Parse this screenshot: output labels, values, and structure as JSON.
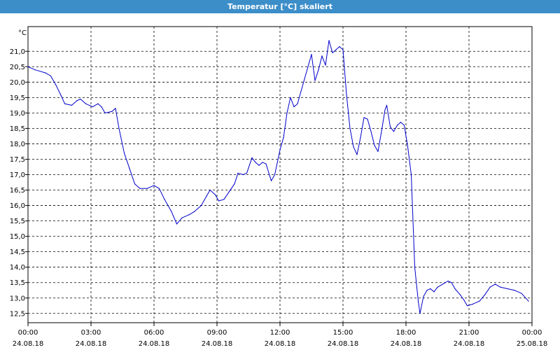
{
  "window": {
    "title": "Temperatur [°C] skaliert"
  },
  "colors": {
    "titlebar": "#3c8ec9",
    "series": "#0000cc",
    "grid": "#000000"
  },
  "chart_data": {
    "type": "line",
    "title": "Temperatur [°C] skaliert",
    "ylabel": "°C",
    "xlabel": "",
    "ylim": [
      12.2,
      21.8
    ],
    "xlim": [
      "2018-08-24 00:00",
      "2018-08-25 00:00"
    ],
    "grid": true,
    "legend": "none",
    "y_ticks": [
      "12,5",
      "13,0",
      "13,5",
      "14,0",
      "14,5",
      "15,0",
      "15,5",
      "16,0",
      "16,5",
      "17,0",
      "17,5",
      "18,0",
      "18,5",
      "19,0",
      "19,5",
      "20,0",
      "20,5",
      "21,0"
    ],
    "x_ticks": [
      {
        "time": "00:00",
        "date": "24.08.18"
      },
      {
        "time": "03:00",
        "date": "24.08.18"
      },
      {
        "time": "06:00",
        "date": "24.08.18"
      },
      {
        "time": "09:00",
        "date": "24.08.18"
      },
      {
        "time": "12:00",
        "date": "24.08.18"
      },
      {
        "time": "15:00",
        "date": "24.08.18"
      },
      {
        "time": "18:00",
        "date": "24.08.18"
      },
      {
        "time": "21:00",
        "date": "24.08.18"
      },
      {
        "time": "00:00",
        "date": "25.08.18"
      }
    ],
    "series": [
      {
        "color": "#0000cc",
        "points": [
          [
            "2018-08-24 00:00",
            20.5
          ],
          [
            "2018-08-24 00:20",
            20.4
          ],
          [
            "2018-08-24 00:50",
            20.3
          ],
          [
            "2018-08-24 01:05",
            20.2
          ],
          [
            "2018-08-24 01:20",
            19.9
          ],
          [
            "2018-08-24 01:35",
            19.55
          ],
          [
            "2018-08-24 01:45",
            19.3
          ],
          [
            "2018-08-24 02:05",
            19.25
          ],
          [
            "2018-08-24 02:20",
            19.4
          ],
          [
            "2018-08-24 02:30",
            19.45
          ],
          [
            "2018-08-24 02:45",
            19.3
          ],
          [
            "2018-08-24 03:05",
            19.2
          ],
          [
            "2018-08-24 03:20",
            19.3
          ],
          [
            "2018-08-24 03:30",
            19.2
          ],
          [
            "2018-08-24 03:40",
            19.0
          ],
          [
            "2018-08-24 04:00",
            19.05
          ],
          [
            "2018-08-24 04:10",
            19.15
          ],
          [
            "2018-08-24 04:20",
            18.5
          ],
          [
            "2018-08-24 04:35",
            17.7
          ],
          [
            "2018-08-24 04:50",
            17.2
          ],
          [
            "2018-08-24 05:05",
            16.7
          ],
          [
            "2018-08-24 05:20",
            16.55
          ],
          [
            "2018-08-24 05:40",
            16.55
          ],
          [
            "2018-08-24 06:00",
            16.65
          ],
          [
            "2018-08-24 06:15",
            16.55
          ],
          [
            "2018-08-24 06:30",
            16.2
          ],
          [
            "2018-08-24 06:50",
            15.8
          ],
          [
            "2018-08-24 07:05",
            15.4
          ],
          [
            "2018-08-24 07:20",
            15.6
          ],
          [
            "2018-08-24 07:40",
            15.7
          ],
          [
            "2018-08-24 07:55",
            15.8
          ],
          [
            "2018-08-24 08:15",
            16.0
          ],
          [
            "2018-08-24 08:30",
            16.3
          ],
          [
            "2018-08-24 08:40",
            16.5
          ],
          [
            "2018-08-24 08:55",
            16.35
          ],
          [
            "2018-08-24 09:05",
            16.15
          ],
          [
            "2018-08-24 09:20",
            16.2
          ],
          [
            "2018-08-24 09:35",
            16.45
          ],
          [
            "2018-08-24 09:50",
            16.7
          ],
          [
            "2018-08-24 10:00",
            17.05
          ],
          [
            "2018-08-24 10:15",
            17.0
          ],
          [
            "2018-08-24 10:25",
            17.05
          ],
          [
            "2018-08-24 10:40",
            17.55
          ],
          [
            "2018-08-24 10:50",
            17.4
          ],
          [
            "2018-08-24 11:00",
            17.3
          ],
          [
            "2018-08-24 11:10",
            17.4
          ],
          [
            "2018-08-24 11:20",
            17.35
          ],
          [
            "2018-08-24 11:35",
            16.8
          ],
          [
            "2018-08-24 11:45",
            17.0
          ],
          [
            "2018-08-24 12:00",
            17.8
          ],
          [
            "2018-08-24 12:10",
            18.2
          ],
          [
            "2018-08-24 12:20",
            19.0
          ],
          [
            "2018-08-24 12:30",
            19.5
          ],
          [
            "2018-08-24 12:40",
            19.2
          ],
          [
            "2018-08-24 12:50",
            19.3
          ],
          [
            "2018-08-24 13:00",
            19.7
          ],
          [
            "2018-08-24 13:10",
            20.1
          ],
          [
            "2018-08-24 13:20",
            20.5
          ],
          [
            "2018-08-24 13:30",
            20.9
          ],
          [
            "2018-08-24 13:40",
            20.05
          ],
          [
            "2018-08-24 13:50",
            20.4
          ],
          [
            "2018-08-24 14:00",
            20.85
          ],
          [
            "2018-08-24 14:10",
            20.55
          ],
          [
            "2018-08-24 14:20",
            21.35
          ],
          [
            "2018-08-24 14:30",
            20.95
          ],
          [
            "2018-08-24 14:40",
            21.05
          ],
          [
            "2018-08-24 14:50",
            21.15
          ],
          [
            "2018-08-24 15:00",
            21.05
          ],
          [
            "2018-08-24 15:10",
            19.6
          ],
          [
            "2018-08-24 15:20",
            18.5
          ],
          [
            "2018-08-24 15:30",
            17.9
          ],
          [
            "2018-08-24 15:40",
            17.65
          ],
          [
            "2018-08-24 15:50",
            18.2
          ],
          [
            "2018-08-24 16:00",
            18.85
          ],
          [
            "2018-08-24 16:10",
            18.8
          ],
          [
            "2018-08-24 16:20",
            18.4
          ],
          [
            "2018-08-24 16:30",
            17.95
          ],
          [
            "2018-08-24 16:40",
            17.75
          ],
          [
            "2018-08-24 16:50",
            18.4
          ],
          [
            "2018-08-24 17:00",
            19.1
          ],
          [
            "2018-08-24 17:05",
            19.25
          ],
          [
            "2018-08-24 17:15",
            18.55
          ],
          [
            "2018-08-24 17:25",
            18.4
          ],
          [
            "2018-08-24 17:35",
            18.6
          ],
          [
            "2018-08-24 17:45",
            18.7
          ],
          [
            "2018-08-24 17:55",
            18.6
          ],
          [
            "2018-08-24 18:05",
            17.9
          ],
          [
            "2018-08-24 18:15",
            17.0
          ],
          [
            "2018-08-24 18:25",
            14.0
          ],
          [
            "2018-08-24 18:35",
            12.9
          ],
          [
            "2018-08-24 18:40",
            12.5
          ],
          [
            "2018-08-24 18:50",
            13.05
          ],
          [
            "2018-08-24 19:00",
            13.25
          ],
          [
            "2018-08-24 19:10",
            13.3
          ],
          [
            "2018-08-24 19:20",
            13.2
          ],
          [
            "2018-08-24 19:30",
            13.35
          ],
          [
            "2018-08-24 19:45",
            13.45
          ],
          [
            "2018-08-24 20:00",
            13.55
          ],
          [
            "2018-08-24 20:10",
            13.5
          ],
          [
            "2018-08-24 20:20",
            13.3
          ],
          [
            "2018-08-24 20:35",
            13.1
          ],
          [
            "2018-08-24 20:45",
            12.95
          ],
          [
            "2018-08-24 20:55",
            12.75
          ],
          [
            "2018-08-24 21:10",
            12.8
          ],
          [
            "2018-08-24 21:30",
            12.9
          ],
          [
            "2018-08-24 21:45",
            13.1
          ],
          [
            "2018-08-24 22:00",
            13.35
          ],
          [
            "2018-08-24 22:15",
            13.45
          ],
          [
            "2018-08-24 22:30",
            13.35
          ],
          [
            "2018-08-24 22:50",
            13.3
          ],
          [
            "2018-08-24 23:10",
            13.25
          ],
          [
            "2018-08-24 23:30",
            13.15
          ],
          [
            "2018-08-24 23:50",
            12.9
          ]
        ]
      }
    ]
  }
}
